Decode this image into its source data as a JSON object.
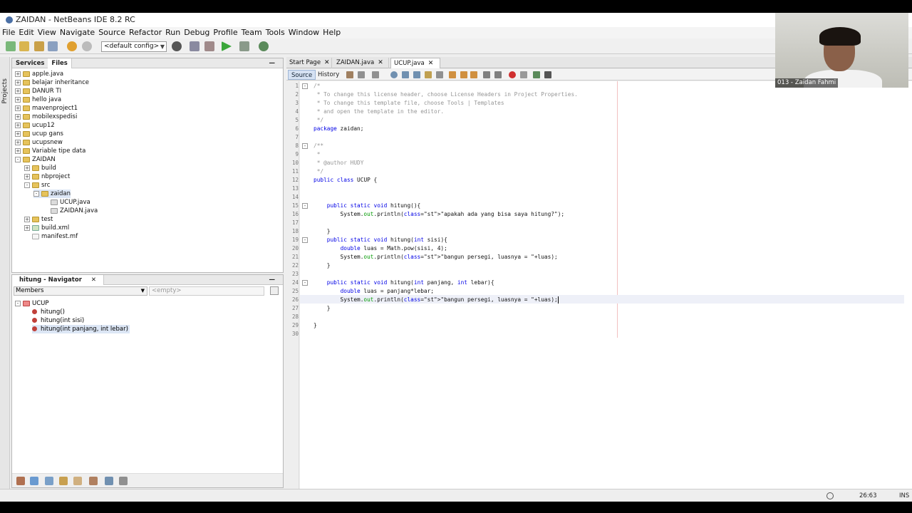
{
  "window": {
    "title": "ZAIDAN - NetBeans IDE 8.2 RC"
  },
  "menu": [
    "File",
    "Edit",
    "View",
    "Navigate",
    "Source",
    "Refactor",
    "Run",
    "Debug",
    "Profile",
    "Team",
    "Tools",
    "Window",
    "Help"
  ],
  "toolbar": {
    "config": "<default config>"
  },
  "side_strip": {
    "label": "Projects"
  },
  "files_panel": {
    "tabs": [
      "Services",
      "Files"
    ],
    "items": [
      {
        "label": "apple.java",
        "depth": 0,
        "type": "folder",
        "exp": "+"
      },
      {
        "label": "belajar inheritance",
        "depth": 0,
        "type": "folder",
        "exp": "+"
      },
      {
        "label": "DANUR TI",
        "depth": 0,
        "type": "folder",
        "exp": "+"
      },
      {
        "label": "hello java",
        "depth": 0,
        "type": "folder",
        "exp": "+"
      },
      {
        "label": "mavenproject1",
        "depth": 0,
        "type": "folder",
        "exp": "+"
      },
      {
        "label": "mobilexspedisi",
        "depth": 0,
        "type": "folder",
        "exp": "+"
      },
      {
        "label": "ucup12",
        "depth": 0,
        "type": "folder",
        "exp": "+"
      },
      {
        "label": "ucup gans",
        "depth": 0,
        "type": "folder",
        "exp": "+"
      },
      {
        "label": "ucupsnew",
        "depth": 0,
        "type": "folder",
        "exp": "+"
      },
      {
        "label": "Variable tipe data",
        "depth": 0,
        "type": "folder",
        "exp": "+"
      },
      {
        "label": "ZAIDAN",
        "depth": 0,
        "type": "folder",
        "exp": "-"
      },
      {
        "label": "build",
        "depth": 1,
        "type": "folder",
        "exp": "+"
      },
      {
        "label": "nbproject",
        "depth": 1,
        "type": "folder",
        "exp": "+"
      },
      {
        "label": "src",
        "depth": 1,
        "type": "folder",
        "exp": "-"
      },
      {
        "label": "zaidan",
        "depth": 2,
        "type": "folder",
        "exp": "-",
        "selected": true
      },
      {
        "label": "UCUP.java",
        "depth": 3,
        "type": "jfile",
        "exp": ""
      },
      {
        "label": "ZAIDAN.java",
        "depth": 3,
        "type": "jfile",
        "exp": ""
      },
      {
        "label": "test",
        "depth": 1,
        "type": "folder",
        "exp": "+"
      },
      {
        "label": "build.xml",
        "depth": 1,
        "type": "xfile",
        "exp": "+"
      },
      {
        "label": "manifest.mf",
        "depth": 1,
        "type": "mffile",
        "exp": ""
      }
    ]
  },
  "navigator": {
    "title": "hitung - Navigator",
    "members_label": "Members",
    "filter_placeholder": "<empty>",
    "class_name": "UCUP",
    "members": [
      "hitung()",
      "hitung(int sisi)",
      "hitung(int panjang, int lebar)"
    ]
  },
  "editor": {
    "tabs": [
      "Start Page",
      "ZAIDAN.java",
      "UCUP.java"
    ],
    "active_tab": "UCUP.java",
    "source_label": "Source",
    "history_label": "History",
    "line_numbers": [
      "1",
      "2",
      "3",
      "4",
      "5",
      "6",
      "7",
      "8",
      "9",
      "10",
      "11",
      "12",
      "13",
      "14",
      "15",
      "16",
      "17",
      "18",
      "19",
      "20",
      "21",
      "22",
      "23",
      "24",
      "25",
      "26",
      "27",
      "28",
      "29",
      "30"
    ],
    "lines": [
      "/*",
      " * To change this license header, choose License Headers in Project Properties.",
      " * To change this template file, choose Tools | Templates",
      " * and open the template in the editor.",
      " */",
      "package zaidan;",
      "",
      "/**",
      " *",
      " * @author HUDY",
      " */",
      "public class UCUP {",
      "",
      "",
      "    public static void hitung(){",
      "        System.out.println(\"apakah ada yang bisa saya hitung?\");",
      "",
      "    }",
      "    public static void hitung(int sisi){",
      "        double luas = Math.pow(sisi, 4);",
      "        System.out.println(\"bangun persegi, luasnya = \"+luas);",
      "    }",
      "",
      "    public static void hitung(int panjang, int lebar){",
      "        double luas = panjang*lebar;",
      "        System.out.println(\"bangun persegi, luasnya = \"+luas);",
      "    }",
      "",
      "}",
      ""
    ]
  },
  "status": {
    "position": "26:63",
    "mode": "INS"
  },
  "webcam": {
    "name": "013 - Zaidan Fahmi"
  }
}
